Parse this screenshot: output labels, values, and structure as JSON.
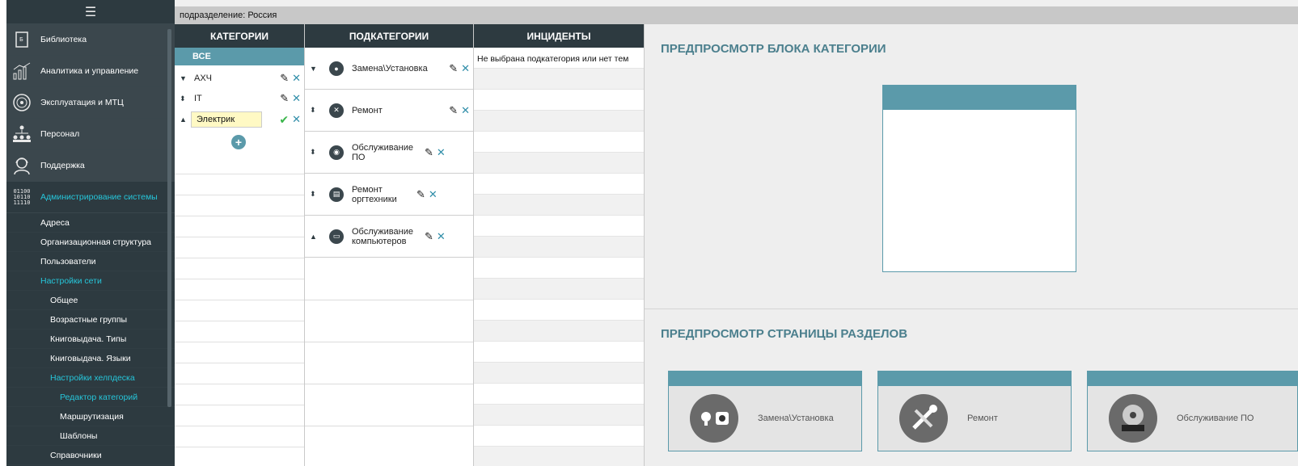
{
  "sidebar": {
    "menu_icon": "menu-icon",
    "items": [
      {
        "label": "Библиотека",
        "icon": "book-icon"
      },
      {
        "label": "Аналитика и управление",
        "icon": "chart-icon"
      },
      {
        "label": "Эксплуатация и МТЦ",
        "icon": "gauge-icon"
      },
      {
        "label": "Персонал",
        "icon": "org-chart-icon"
      },
      {
        "label": "Поддержка",
        "icon": "support-agent-icon"
      },
      {
        "label": "Администрирование системы",
        "icon": "binary-icon",
        "binary": "01100\n10110\n11110"
      }
    ],
    "sub": {
      "addresses": "Адреса",
      "org_structure": "Организационная структура",
      "users": "Пользователи",
      "network_settings": "Настройки сети",
      "general": "Общее",
      "age_groups": "Возрастные группы",
      "book_types": "Книговыдача. Типы",
      "book_languages": "Книговыдача. Языки",
      "helpdesk_settings": "Настройки хелпдеска",
      "category_editor": "Редактор категорий",
      "routing": "Маршрутизация",
      "templates": "Шаблоны",
      "references": "Справочники"
    }
  },
  "topbar": {
    "breadcrumb": "подразделение: Россия"
  },
  "categories": {
    "header": "КАТЕГОРИИ",
    "all_label": "ВСЕ",
    "items": [
      {
        "name": "АХЧ",
        "arrow": "▼"
      },
      {
        "name": "IT",
        "arrow": "⬍"
      }
    ],
    "editing": {
      "value": "Электрик",
      "arrow": "▲"
    }
  },
  "subcategories": {
    "header": "ПОДКАТЕГОРИИ",
    "items": [
      {
        "name": "Замена\\Установка",
        "arrow": "▼",
        "icon": "replace-icon"
      },
      {
        "name": "Ремонт",
        "arrow": "⬍",
        "icon": "repair-icon"
      },
      {
        "name": "Обслуживание ПО",
        "arrow": "⬍",
        "icon": "software-disc-icon"
      },
      {
        "name": "Ремонт оргтехники",
        "arrow": "⬍",
        "icon": "printer-icon"
      },
      {
        "name": "Обслуживание компьютеров",
        "arrow": "▲",
        "icon": "computer-icon"
      }
    ]
  },
  "incidents": {
    "header": "ИНЦИДЕНТЫ",
    "empty_text": "Не выбрана подкатегория или нет тем"
  },
  "preview": {
    "block_title": "ПРЕДПРОСМОТР БЛОКА КАТЕГОРИИ",
    "page_title": "ПРЕДПРОСМОТР СТРАНИЦЫ РАЗДЕЛОВ",
    "tiles": [
      {
        "label": "Замена\\Установка",
        "icon": "bulb-socket-icon"
      },
      {
        "label": "Ремонт",
        "icon": "tools-icon"
      },
      {
        "label": "Обслуживание ПО",
        "icon": "disc-icon"
      }
    ]
  },
  "colors": {
    "sidebar": "#2d3a40",
    "accent": "#5b9aaa",
    "teal_text": "#26c6da"
  }
}
